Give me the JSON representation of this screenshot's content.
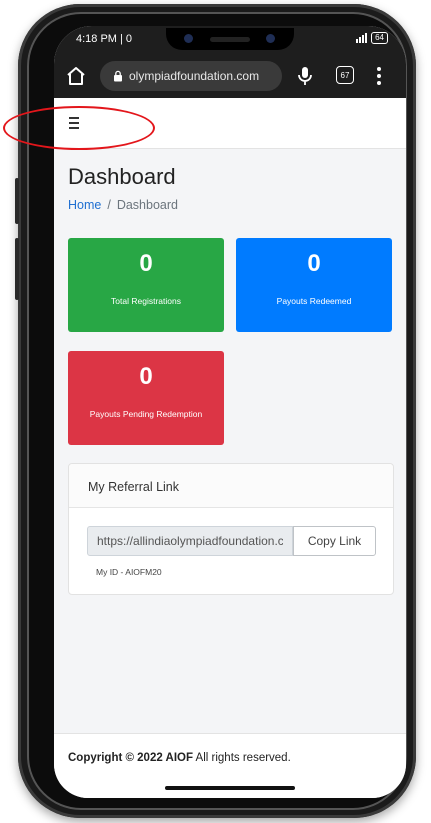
{
  "status_bar": {
    "time": "4:18 PM | 0",
    "battery": "64"
  },
  "browser": {
    "url": "olympiadfoundation.com",
    "tab_count": "67",
    "icons": [
      "home-icon",
      "lock-icon",
      "mic-icon",
      "tabs-icon",
      "overflow-menu-icon"
    ]
  },
  "navbar": {
    "menu_icon": "hamburger-menu-icon"
  },
  "page": {
    "title": "Dashboard",
    "breadcrumb": {
      "home": "Home",
      "separator": "/",
      "current": "Dashboard"
    }
  },
  "stats": [
    {
      "value": "0",
      "label": "Total Registrations",
      "color": "#28a745"
    },
    {
      "value": "0",
      "label": "Payouts Redeemed",
      "color": "#007bff"
    },
    {
      "value": "0",
      "label": "Payouts Pending Redemption",
      "color": "#dc3545"
    }
  ],
  "referral": {
    "title": "My Referral Link",
    "link": "https://allindiaolympiadfoundation.com",
    "copy_label": "Copy Link",
    "my_id": "My ID - AIOFM20"
  },
  "footer": {
    "copyright": "Copyright © 2022 AIOF",
    "rights": "All rights reserved."
  },
  "annotation": {
    "highlight_color": "#e3161b"
  }
}
